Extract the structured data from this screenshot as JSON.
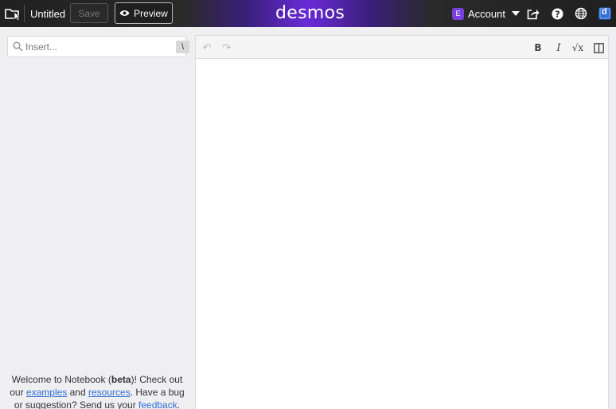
{
  "header": {
    "title": "Untitled",
    "save_label": "Save",
    "preview_label": "Preview",
    "logo_text": "desmos",
    "account_initial": "E",
    "account_label": "Account",
    "d_icon_text": "d"
  },
  "sidebar": {
    "search_placeholder": "Insert...",
    "shortcut_key": "\\",
    "welcome": {
      "t1": "Welcome to Notebook (",
      "beta": "beta",
      "t2": ")! Check out our ",
      "examples": "examples",
      "t3": " and ",
      "resources": "resources",
      "t4": ". Have a bug or suggestion? Send us your ",
      "feedback": "feedback",
      "t5": "."
    }
  },
  "toolbar": {
    "undo_glyph": "↶",
    "redo_glyph": "↷",
    "bold_glyph": "B",
    "italic_glyph": "I",
    "sqrt_glyph": "√x"
  },
  "colors": {
    "accent_purple": "#6a2ad8",
    "link_blue": "#2d6fd3",
    "d_icon_blue": "#2f6fd6"
  },
  "icons": [
    "folder-icon",
    "eye-icon",
    "share-icon",
    "help-icon",
    "globe-icon",
    "desmos-d-icon",
    "search-icon",
    "split-view-icon"
  ]
}
